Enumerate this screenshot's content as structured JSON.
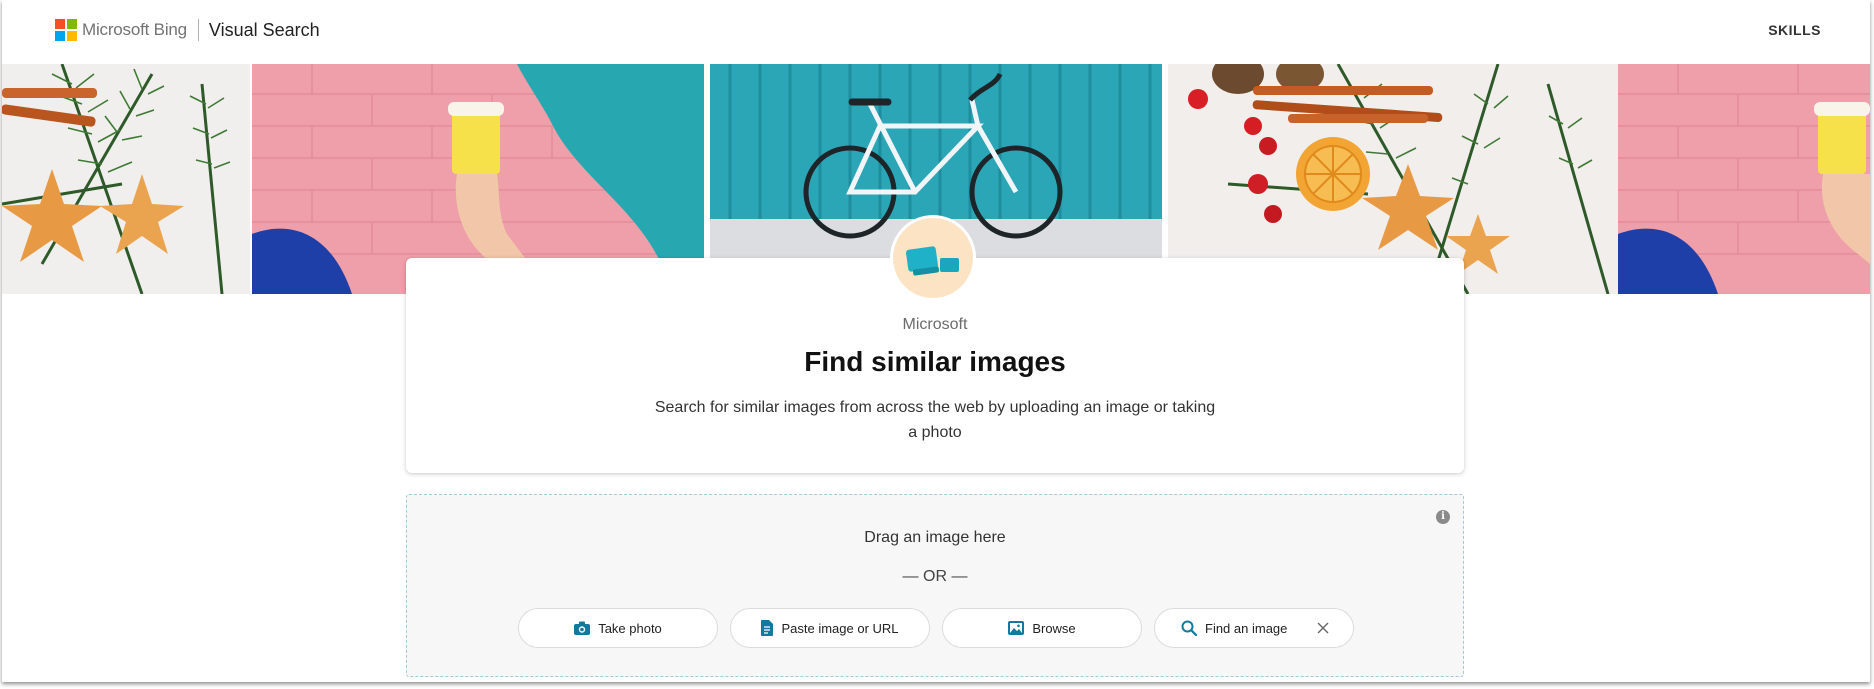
{
  "header": {
    "brand": "Microsoft Bing",
    "product": "Visual Search",
    "skills_label": "SKILLS"
  },
  "hero": {
    "tiles": [
      "christmas-decor",
      "hand-holding-cup-pink-wall",
      "bicycle-teal-wall",
      "christmas-decor",
      "hand-holding-cup-pink-wall"
    ]
  },
  "card": {
    "provider": "Microsoft",
    "title": "Find similar images",
    "description": "Search for similar images from across the web by uploading an image or taking a photo"
  },
  "dropzone": {
    "drag_text": "Drag an image here",
    "or_text": "— OR —",
    "buttons": {
      "take_photo": "Take photo",
      "paste": "Paste image or URL",
      "browse": "Browse",
      "find": "Find an image"
    }
  },
  "colors": {
    "accent": "#0f7a9c",
    "dash_border": "#9fc9d6",
    "badge_bg": "#fce3c4"
  },
  "icons": [
    "camera-icon",
    "document-icon",
    "image-icon",
    "search-icon",
    "close-icon",
    "info-icon"
  ]
}
